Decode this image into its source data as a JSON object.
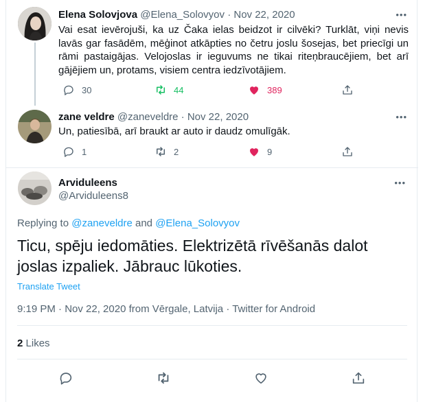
{
  "tweet1": {
    "name": "Elena Solovjova",
    "handle": "@Elena_Solovyov",
    "separator": "·",
    "date": "Nov 22, 2020",
    "more": "•••",
    "text": "Vai esat ievērojuši, ka uz Čaka ielas beidzot ir cilvēki? Turklāt, viņi nevis lavās gar fasādēm, mēģinot atkāpties no četru joslu šosejas, bet priecīgi un rāmi pastaigājas. Velojoslas ir ieguvums ne tikai riteņbraucējiem, bet arī gājējiem un, protams, visiem centra iedzīvotājiem.",
    "replies": "30",
    "retweets": "44",
    "likes": "389"
  },
  "tweet2": {
    "name": "zane veldre",
    "handle": "@zaneveldre",
    "separator": "·",
    "date": "Nov 22, 2020",
    "more": "•••",
    "text": "Un, patiesībā, arī braukt ar auto ir daudz omulīgāk.",
    "replies": "1",
    "retweets": "2",
    "likes": "9"
  },
  "focus": {
    "name": "Arviduleens",
    "handle": "@Arviduleens8",
    "more": "•••",
    "replying_prefix": "Replying to",
    "replying_user1": "@zaneveldre",
    "replying_and": "and",
    "replying_user2": "@Elena_Solovyov",
    "text": "Ticu, spēju iedomāties. Elektrizētā rīvēšanās dalot joslas izpaliek. Jābrauc lūkoties.",
    "translate": "Translate Tweet",
    "meta": "9:19 PM · Nov 22, 2020 from Vērgale, Latvija · Twitter for Android",
    "likes_count": "2",
    "likes_label": "Likes"
  },
  "colors": {
    "accent": "#1da1f2",
    "retweet_green": "#17bf63",
    "like_pink": "#e0245e",
    "muted": "#536471"
  },
  "icons": [
    "reply-icon",
    "retweet-icon",
    "like-icon",
    "share-icon",
    "more-icon"
  ]
}
